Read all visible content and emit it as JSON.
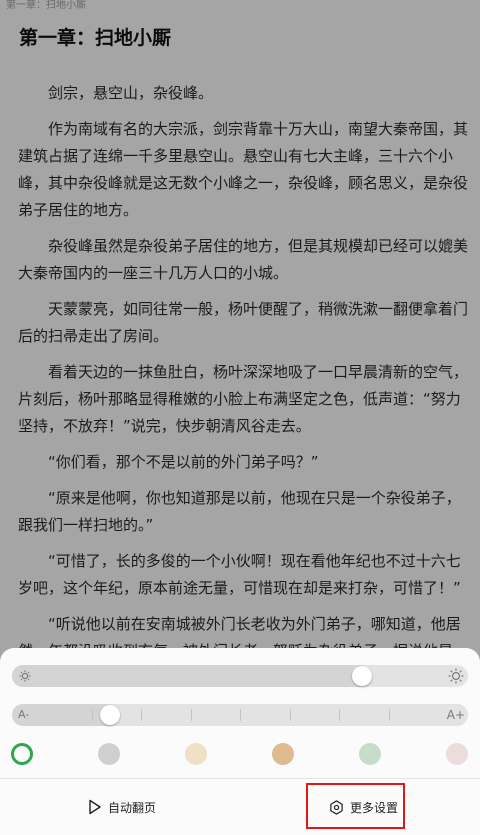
{
  "reader": {
    "running_head": "第一章：扫地小厮",
    "chapter_title": "第一章：扫地小厮",
    "paragraphs": [
      "剑宗，悬空山，杂役峰。",
      "作为南域有名的大宗派，剑宗背靠十万大山，南望大秦帝国，其建筑占据了连绵一千多里悬空山。悬空山有七大主峰，三十六个小峰，其中杂役峰就是这无数个小峰之一，杂役峰，顾名思义，是杂役弟子居住的地方。",
      "杂役峰虽然是杂役弟子居住的地方，但是其规模却已经可以媲美大秦帝国内的一座三十几万人口的小城。",
      "天蒙蒙亮，如同往常一般，杨叶便醒了，稍微洗漱一翻便拿着门后的扫帚走出了房间。",
      "看着天边的一抹鱼肚白，杨叶深深地吸了一口早晨清新的空气，片刻后，杨叶那略显得稚嫩的小脸上布满坚定之色，低声道：“努力坚持，不放弃！”说完，快步朝清风谷走去。",
      "“你们看，那个不是以前的外门弟子吗？”",
      "“原来是他啊，你也知道那是以前，他现在只是一个杂役弟子，跟我们一样扫地的。”",
      "“可惜了，长的多俊的一个小伙啊！现在看他年纪也不过十六七岁吧，这个年纪，原本前途无量，可惜现在却是来打杂，可惜了！”",
      "“听说他以前在安南城被外门长老收为外门弟子，哪知道，他居然一年都没吸收到玄气，被外门长老一怒贬为杂役弟子。据说他是"
    ]
  },
  "settings": {
    "brightness": {
      "level": 0.78,
      "low_icon": "sun-small-icon",
      "high_icon": "sun-large-icon"
    },
    "font_size": {
      "level": 0.2,
      "steps": 8,
      "decrease_label": "A-",
      "increase_label": "A+"
    },
    "themes": [
      {
        "name": "default",
        "color": "#ffffff",
        "selected": true
      },
      {
        "name": "gray",
        "color": "#cfcfcf",
        "selected": false
      },
      {
        "name": "parchment",
        "color": "#efe0c6",
        "selected": false
      },
      {
        "name": "tan",
        "color": "#ddbb8e",
        "selected": false
      },
      {
        "name": "green",
        "color": "#c6dec9",
        "selected": false
      },
      {
        "name": "pink",
        "color": "#ecdcdc",
        "selected": false
      }
    ],
    "accent_color": "#2fa54f",
    "highlight_color": "#e01818",
    "auto_page_label": "自动翻页",
    "more_settings_label": "更多设置"
  }
}
